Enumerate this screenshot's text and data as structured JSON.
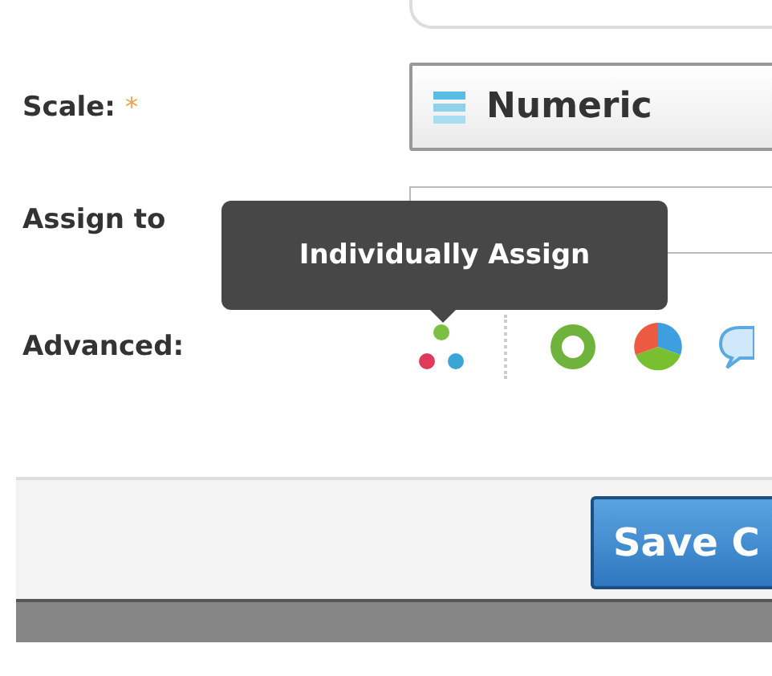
{
  "form": {
    "rows": [
      {
        "kind": "select",
        "label": "Scale:",
        "required_mark": "*",
        "value": "Numeric"
      },
      {
        "kind": "field",
        "label": "Assign to"
      },
      {
        "kind": "icons",
        "label": "Advanced:"
      }
    ]
  },
  "tooltip": {
    "text": "Individually Assign"
  },
  "footer": {
    "buttons": [
      "Save C"
    ]
  }
}
